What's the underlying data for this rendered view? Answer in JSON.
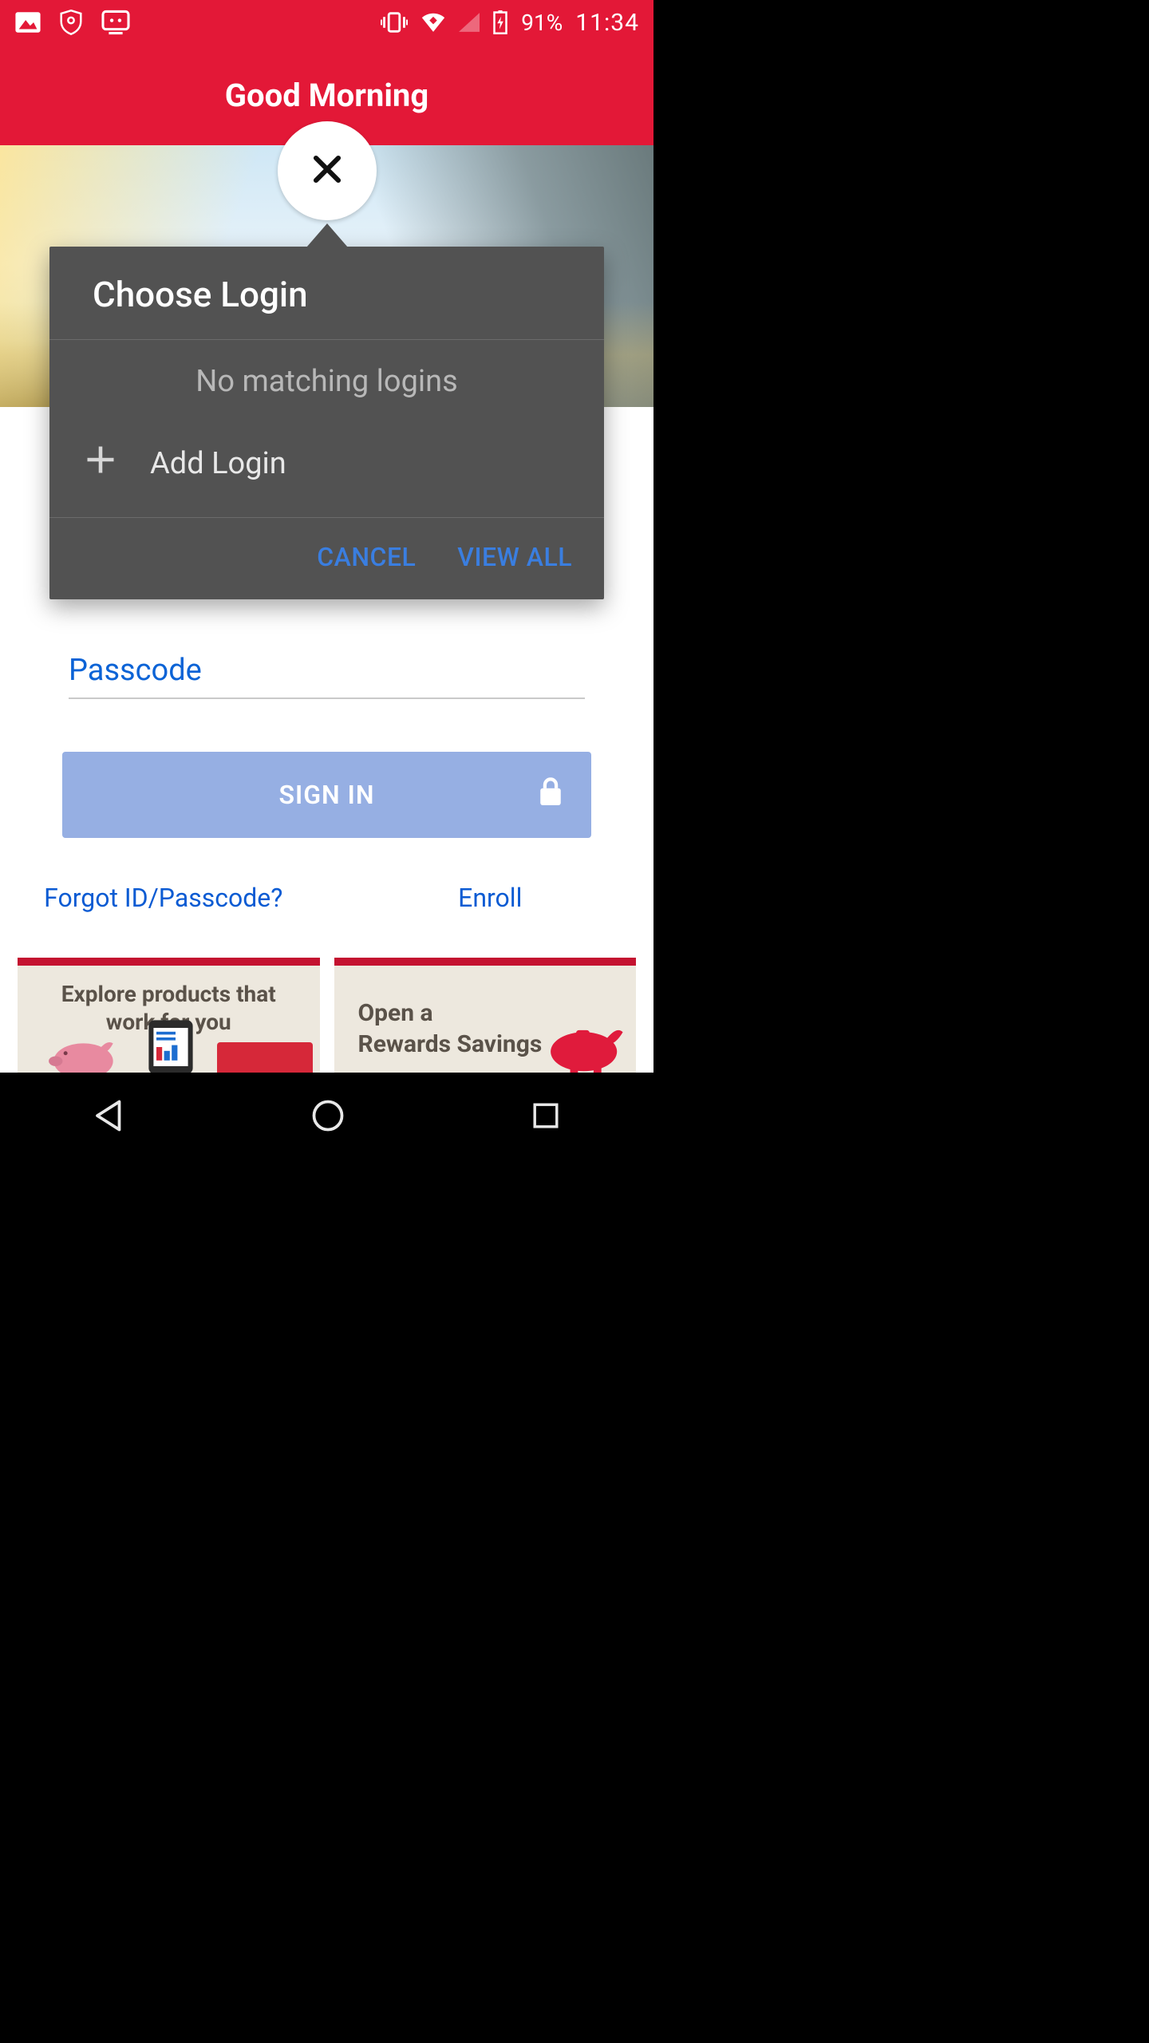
{
  "status": {
    "battery_pct": "91%",
    "clock": "11:34"
  },
  "header": {
    "greeting": "Good Morning"
  },
  "popup": {
    "title": "Choose Login",
    "no_match": "No matching logins",
    "add_login": "Add Login",
    "cancel": "CANCEL",
    "view_all": "VIEW ALL"
  },
  "login": {
    "passcode_label": "Passcode",
    "signin_label": "SIGN IN",
    "forgot_link": "Forgot ID/Passcode?",
    "enroll_link": "Enroll"
  },
  "cards": {
    "c1_line1": "Explore products that",
    "c1_line2": "work for you",
    "c2_line1": "Open a",
    "c2_line2": "Rewards Savings"
  }
}
